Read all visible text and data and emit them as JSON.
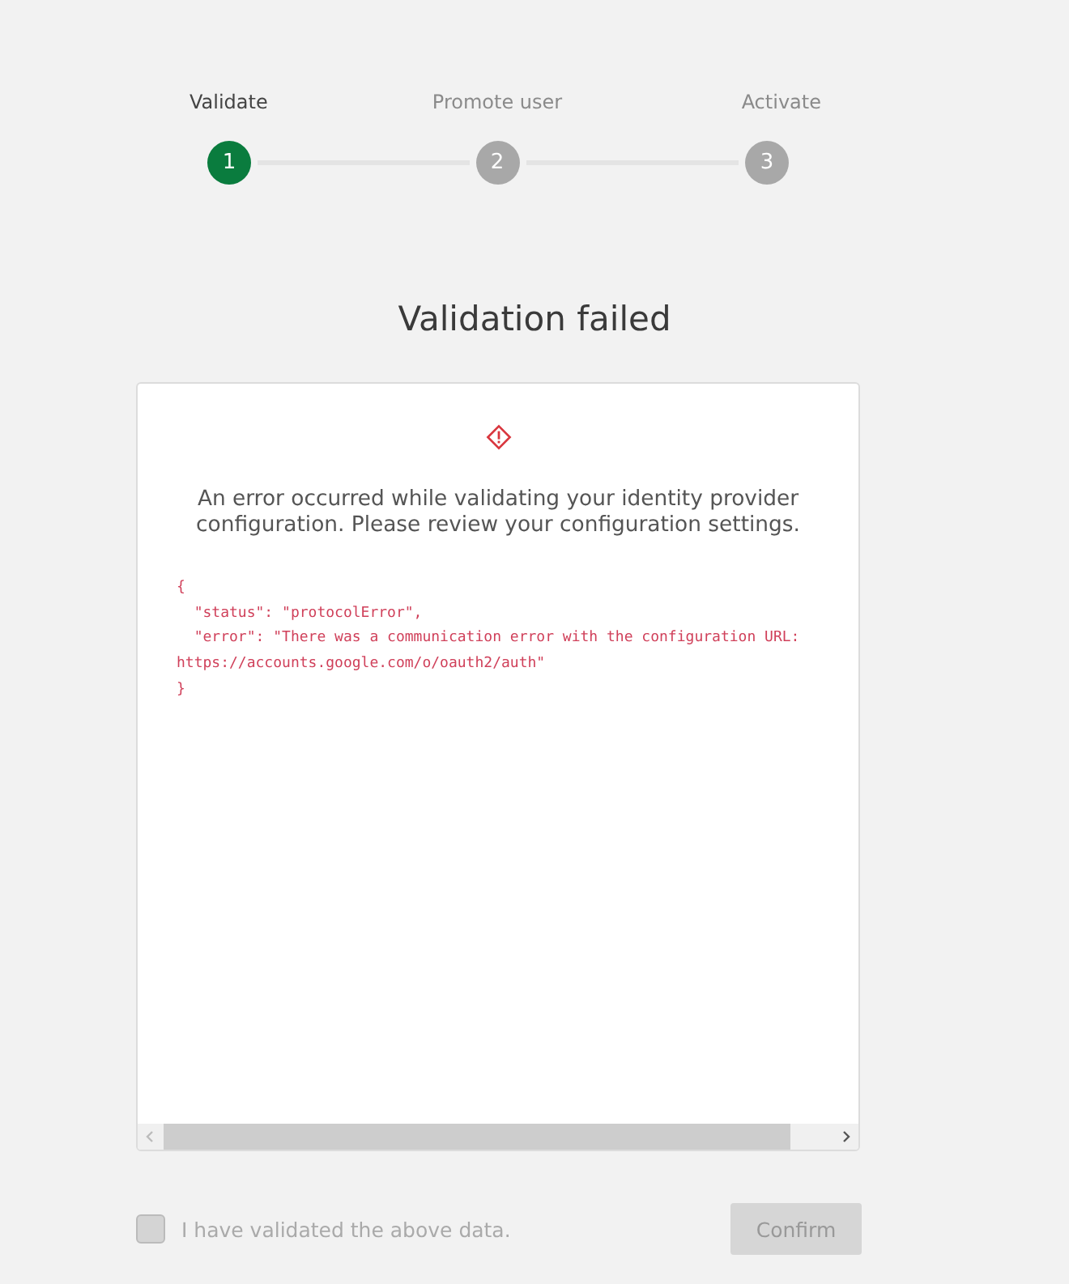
{
  "steps": [
    {
      "label": "Validate",
      "number": "1",
      "active": true
    },
    {
      "label": "Promote user",
      "number": "2",
      "active": false
    },
    {
      "label": "Activate",
      "number": "3",
      "active": false
    }
  ],
  "title": "Validation failed",
  "message": "An error occurred while validating your identity provider configuration. Please review your configuration settings.",
  "code_lines": [
    "{",
    "  \"status\": \"protocolError\",",
    "  \"error\": \"There was a communication error with the configuration URL:",
    "https://accounts.google.com/o/oauth2/auth\"",
    "}"
  ],
  "confirm_checkbox": {
    "label": "I have validated the above data.",
    "checked": false,
    "disabled": true
  },
  "confirm_button": {
    "label": "Confirm",
    "disabled": true
  }
}
